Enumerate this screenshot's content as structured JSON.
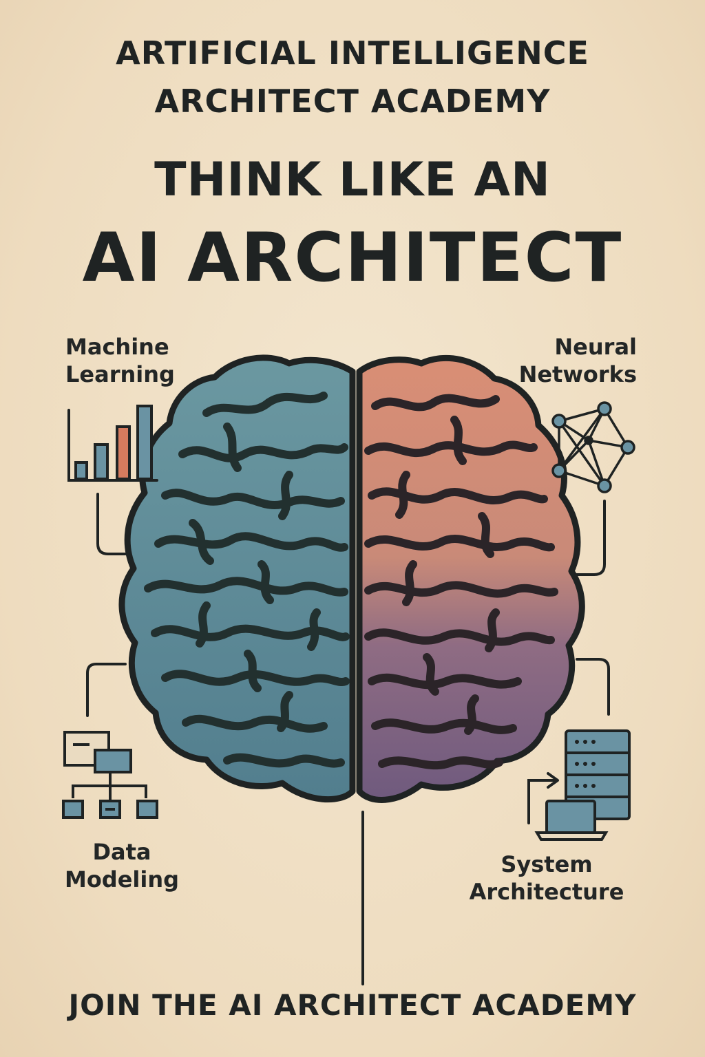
{
  "header": {
    "line1": "ARTIFICIAL INTELLIGENCE",
    "line2": "ARCHITECT ACADEMY",
    "tagline_top": "THINK LIKE AN",
    "tagline_main": "AI ARCHITECT"
  },
  "labels": {
    "machine_learning": [
      "Machine",
      "Learning"
    ],
    "neural_networks": [
      "Neural",
      "Networks"
    ],
    "data_modeling": [
      "Data",
      "Modeling"
    ],
    "system_architecture": [
      "System",
      "Architecture"
    ]
  },
  "icons": {
    "machine_learning": "bar-chart-icon",
    "neural_networks": "network-graph-icon",
    "data_modeling": "hierarchy-diagram-icon",
    "system_architecture": "server-laptop-icon"
  },
  "colors": {
    "background": "#f0e2c9",
    "brain_left": "#5e8a97",
    "brain_right_top": "#d98e75",
    "brain_right_bottom": "#6f5a7e",
    "outline": "#1f2323",
    "accent_bar": "#d67b5e",
    "icon_fill": "#6a93a3"
  },
  "footer": {
    "cta": "JOIN THE AI ARCHITECT ACADEMY"
  }
}
